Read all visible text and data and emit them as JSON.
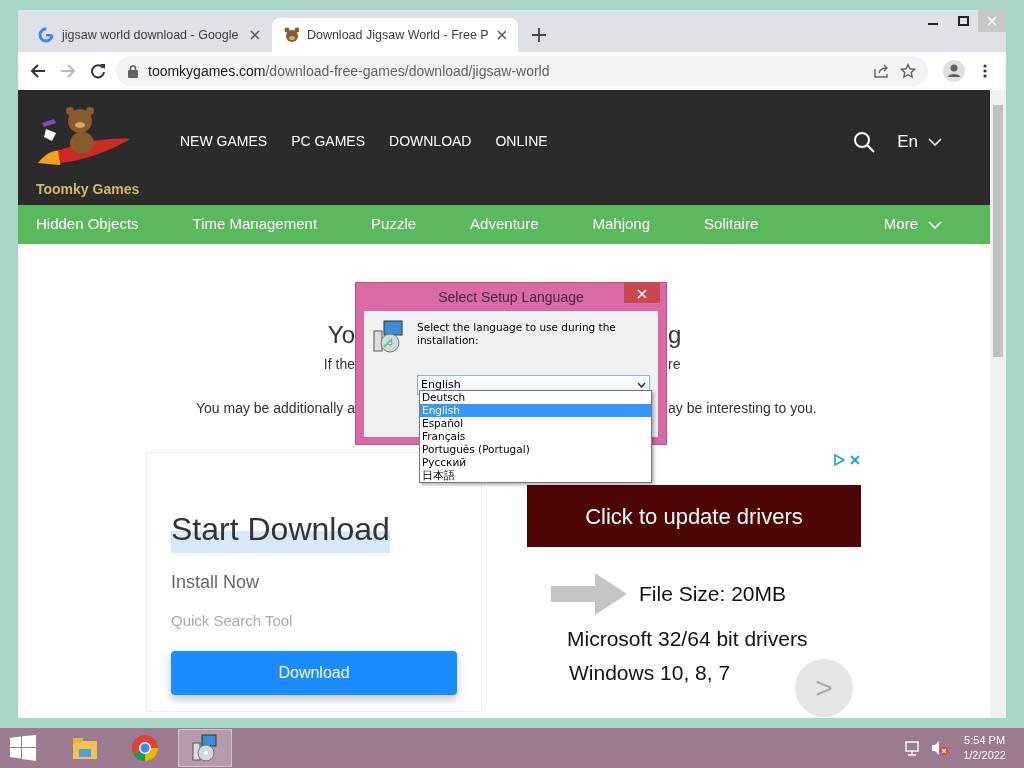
{
  "browser": {
    "tabs": [
      {
        "title": "jigsaw world download - Google",
        "kind": "google",
        "selected": false
      },
      {
        "title": "Download Jigsaw World - Free P",
        "kind": "site",
        "selected": true
      }
    ],
    "address": {
      "host": "toomkygames.com",
      "path": "/download-free-games/download/jigsaw-world"
    }
  },
  "site": {
    "brand": "Toomky Games",
    "nav": [
      "NEW GAMES",
      "PC GAMES",
      "DOWNLOAD",
      "ONLINE"
    ],
    "language": "En",
    "categories": [
      "Hidden Objects",
      "Time Management",
      "Puzzle",
      "Adventure",
      "Mahjong",
      "Solitaire"
    ],
    "more": "More"
  },
  "content": {
    "heading": {
      "left": "Yo",
      "right": "g"
    },
    "subline": {
      "left": "If the",
      "right": "re"
    },
    "note": {
      "left": "You may be additionally a",
      "right": "ay be interesting to you."
    }
  },
  "ads": {
    "left": {
      "title": "Start Download",
      "subtitle": "Install Now",
      "caption": "Quick Search Tool",
      "button": "Download"
    },
    "right": {
      "banner": "Click to update drivers",
      "size": "File Size: 20MB",
      "line1": "Microsoft 32/64 bit drivers",
      "line2": "Windows 10, 8, 7",
      "next": ">"
    }
  },
  "dialog": {
    "title": "Select Setup Language",
    "prompt": "Select the language to use during the installation:",
    "value": "English",
    "options": [
      {
        "label": "Deutsch",
        "selected": false
      },
      {
        "label": "English",
        "selected": true
      },
      {
        "label": "Español",
        "selected": false
      },
      {
        "label": "Français",
        "selected": false
      },
      {
        "label": "Português (Portugal)",
        "selected": false
      },
      {
        "label": "Русский",
        "selected": false
      },
      {
        "label": "日本語",
        "selected": false
      }
    ]
  },
  "taskbar": {
    "apps": [
      {
        "kind": "explorer",
        "active": false
      },
      {
        "kind": "chrome",
        "active": false
      },
      {
        "kind": "setup",
        "active": true
      }
    ],
    "time": "5:54 PM",
    "date": "1/2/2022"
  }
}
